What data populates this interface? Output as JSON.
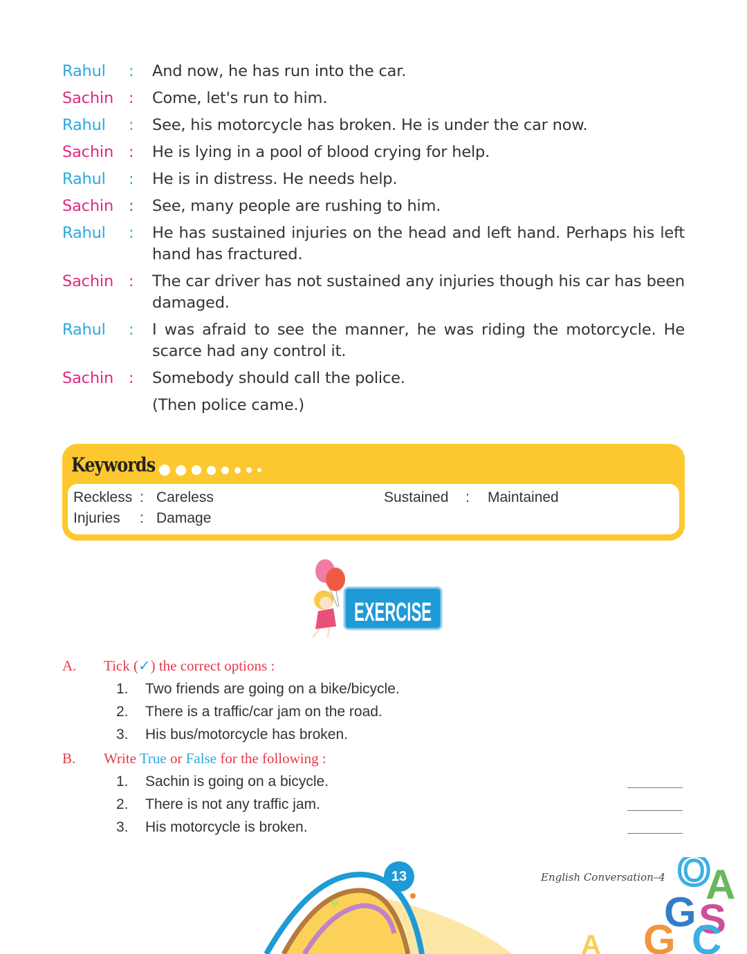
{
  "dialogue": [
    {
      "speaker": "Rahul",
      "text": "And now, he has run into the car."
    },
    {
      "speaker": "Sachin",
      "text": "Come, let's run to him."
    },
    {
      "speaker": "Rahul",
      "text": "See, his motorcycle has broken. He is under the car now."
    },
    {
      "speaker": "Sachin",
      "text": "He is lying in a pool of blood crying for help."
    },
    {
      "speaker": "Rahul",
      "text": "He is in distress. He needs help."
    },
    {
      "speaker": "Sachin",
      "text": "See, many people are rushing to him."
    },
    {
      "speaker": "Rahul",
      "text": "He has sustained injuries on the head and left hand. Perhaps his left hand has fractured."
    },
    {
      "speaker": "Sachin",
      "text": "The car driver has not sustained any injuries though his car has been damaged."
    },
    {
      "speaker": "Rahul",
      "text": "I was afraid to see the manner, he was riding the motorcycle. He scarce had any control it."
    },
    {
      "speaker": "Sachin",
      "text": "Somebody should call the police."
    }
  ],
  "stage_direction": "(Then police came.)",
  "separator": ":",
  "keywords": {
    "title": "Keywords",
    "items": [
      {
        "word": "Reckless",
        "meaning": "Careless"
      },
      {
        "word": "Injuries",
        "meaning": "Damage"
      },
      {
        "word": "Sustained",
        "meaning": "Maintained"
      }
    ]
  },
  "exercise_banner": "EXERCISE",
  "section_a": {
    "letter": "A.",
    "instruction_pre": "Tick (",
    "tick": "✓",
    "instruction_post": ") the correct options :",
    "questions": [
      {
        "num": "1.",
        "text": "Two friends are going on a bike/bicycle."
      },
      {
        "num": "2.",
        "text": "There is a traffic/car jam on the road."
      },
      {
        "num": "3.",
        "text": "His bus/motorcycle has broken."
      }
    ]
  },
  "section_b": {
    "letter": "B.",
    "w1": "Write ",
    "w2": "True",
    "w3": " or ",
    "w4": "False",
    "w5": " for the following :",
    "questions": [
      {
        "num": "1.",
        "text": "Sachin is going on a bicycle."
      },
      {
        "num": "2.",
        "text": "There is not any traffic jam."
      },
      {
        "num": "3.",
        "text": "His motorcycle is broken."
      }
    ]
  },
  "page_number": "13",
  "footer": "English Conversation–4",
  "colors": {
    "rahul": "#29a8e0",
    "sachin": "#e0287f",
    "heading": "#e8384a",
    "keyword_bg": "#fdc82f"
  }
}
